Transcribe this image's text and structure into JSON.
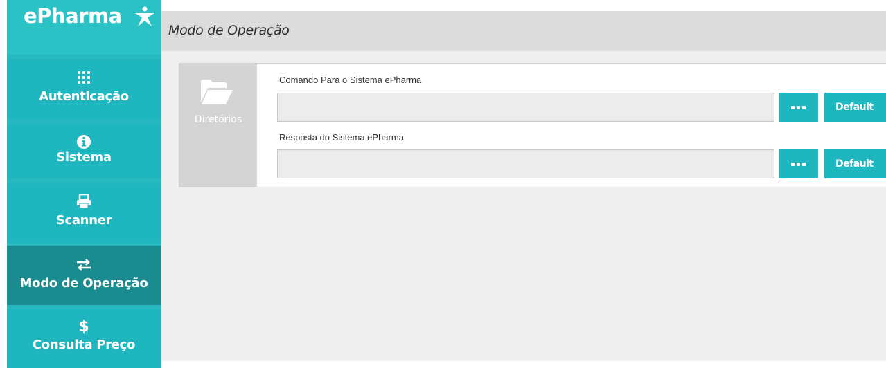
{
  "brand": {
    "name": "ePharma",
    "logo_icon": "person-star-icon"
  },
  "sidebar": {
    "items": [
      {
        "label": "Autenticação",
        "icon": "keypad-icon"
      },
      {
        "label": "Sistema",
        "icon": "info-icon"
      },
      {
        "label": "Scanner",
        "icon": "printer-icon"
      },
      {
        "label": "Modo de Operação",
        "icon": "swap-arrows-icon",
        "active": true
      },
      {
        "label": "Consulta Preço",
        "icon": "dollar-icon"
      }
    ]
  },
  "header": {
    "title": "Modo de Operação"
  },
  "panel": {
    "section_label": "Diretórios",
    "section_icon": "folder-open-icon",
    "fields": [
      {
        "label": "Comando Para o Sistema ePharma",
        "value": "",
        "browse_icon": "ellipsis-icon",
        "default_label": "Default"
      },
      {
        "label": "Resposta do Sistema ePharma",
        "value": "",
        "browse_icon": "ellipsis-icon",
        "default_label": "Default"
      }
    ]
  },
  "colors": {
    "accent": "#1fb7bf",
    "active": "#1a8c90",
    "header_bg": "#dcdcdc",
    "content_bg": "#efefef"
  }
}
